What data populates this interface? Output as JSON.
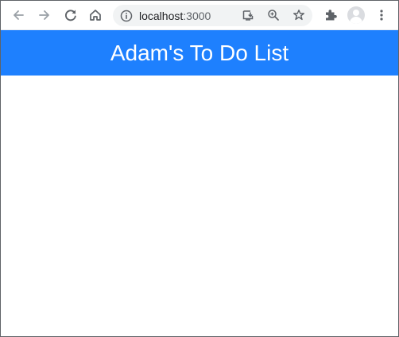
{
  "browser": {
    "url_host": "localhost",
    "url_port": ":3000",
    "icons": {
      "back": "arrow-left-icon",
      "forward": "arrow-right-icon",
      "reload": "reload-icon",
      "home": "home-icon",
      "site_info": "info-icon",
      "install": "install-app-icon",
      "zoom": "zoom-icon",
      "bookmark": "star-icon",
      "extensions": "puzzle-icon",
      "profile": "avatar",
      "menu": "kebab-menu-icon"
    }
  },
  "app": {
    "title": "Adam's To Do List"
  },
  "colors": {
    "header_bg": "#1e80fe",
    "header_text": "#ffffff",
    "omnibox_bg": "#f1f3f4"
  }
}
